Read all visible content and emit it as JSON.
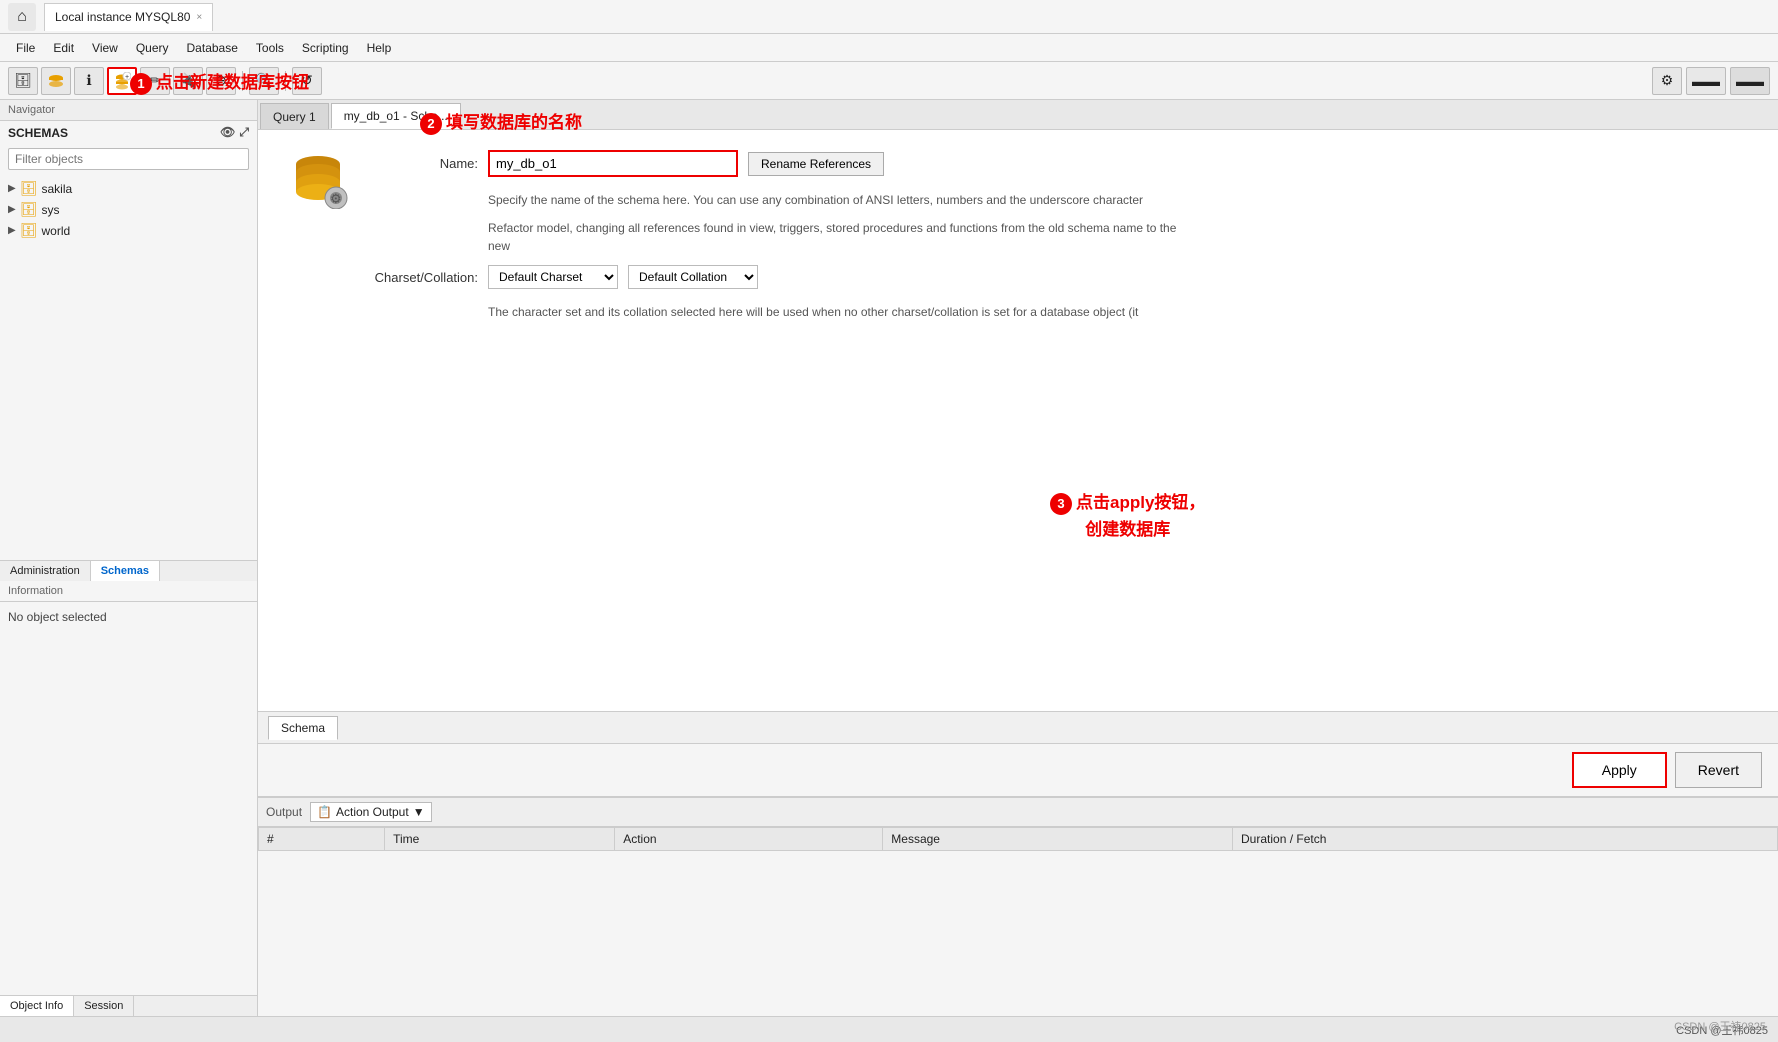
{
  "titlebar": {
    "home_icon": "⌂",
    "tab_label": "Local instance MYSQL80",
    "close_icon": "×"
  },
  "menubar": {
    "items": [
      "File",
      "Edit",
      "View",
      "Query",
      "Database",
      "Tools",
      "Scripting",
      "Help"
    ]
  },
  "toolbar": {
    "buttons": [
      "🗄",
      "🗄",
      "ℹ",
      "🗃",
      "➕",
      "🖊",
      "🔌",
      "🔍",
      "↺"
    ]
  },
  "left_panel": {
    "navigator_label": "Navigator",
    "schemas_label": "SCHEMAS",
    "filter_placeholder": "Filter objects",
    "schemas": [
      "sakila",
      "sys",
      "world"
    ],
    "bottom_tabs": [
      "Administration",
      "Schemas"
    ],
    "info_label": "Information",
    "no_object_label": "No object selected",
    "obj_tabs": [
      "Object Info",
      "Session"
    ]
  },
  "content_tabs": [
    "Query 1",
    "my_db_o1 - Sche..."
  ],
  "schema_editor": {
    "name_label": "Name:",
    "name_value": "my_db_o1",
    "rename_btn_label": "Rename References",
    "desc1": "Specify the name of the schema here. You can use any combination of ANSI letters, numbers and the underscore character",
    "desc2": "Refactor model, changing all references found in view, triggers, stored procedures and functions from the old schema name to the new",
    "charset_label": "Charset/Collation:",
    "charset_value": "Default Charset",
    "collation_value": "Default Collation",
    "charset_desc": "The character set and its collation selected here will be used when no other charset/collation is set for a database object (it",
    "schema_sub_tabs": [
      "Schema"
    ],
    "apply_label": "Apply",
    "revert_label": "Revert"
  },
  "output_section": {
    "label": "Output",
    "dropdown_label": "Action Output",
    "dropdown_icon": "▼",
    "table_headers": [
      "#",
      "Time",
      "Action",
      "Message",
      "Duration / Fetch"
    ]
  },
  "annotations": {
    "annot1_text": "点击新建数据库按钮",
    "annot2_text": "填写数据库的名称",
    "annot3_line1": "点击apply按钮，",
    "annot3_line2": "创建数据库"
  },
  "statusbar": {
    "left": "",
    "right": "CSDN @王祎0825"
  },
  "circle1": "1",
  "circle2": "2",
  "circle3": "3"
}
